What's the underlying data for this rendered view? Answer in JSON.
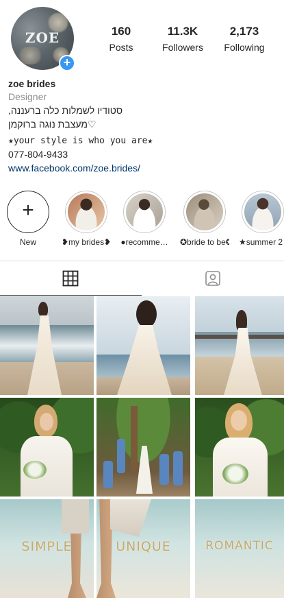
{
  "profile": {
    "avatar_text": "ZOE",
    "stats": [
      {
        "value": "160",
        "label": "Posts"
      },
      {
        "value": "11.3K",
        "label": "Followers"
      },
      {
        "value": "2,173",
        "label": "Following"
      }
    ],
    "name": "zoe brides",
    "category": "Designer",
    "bio_line1": "סטודיו לשמלות כלה ברעננה,",
    "bio_line2": "♡מעצבת נוגה ברוקמן",
    "bio_line3": "★your style is who you are★",
    "phone": "077-804-9433",
    "link": "www.facebook.com/zoe.brides/"
  },
  "highlights": [
    {
      "label": "New",
      "icon": "plus-icon"
    },
    {
      "label": "❥my brides❥"
    },
    {
      "label": "●recomme…"
    },
    {
      "label": "✪bride to be✪"
    },
    {
      "label": "★summer 2"
    }
  ],
  "tabs": [
    {
      "icon": "grid-icon",
      "active": true
    },
    {
      "icon": "tagged-person-icon",
      "active": false
    }
  ],
  "posts": [
    {
      "type": "beach"
    },
    {
      "type": "beach"
    },
    {
      "type": "beach"
    },
    {
      "type": "garden"
    },
    {
      "type": "garden"
    },
    {
      "type": "garden"
    },
    {
      "type": "word",
      "text": "SIMPLE"
    },
    {
      "type": "word",
      "text": "UNIQUE"
    },
    {
      "type": "word",
      "text": "ROMANTIC"
    }
  ],
  "colors": {
    "accent": "#3897f0",
    "link": "#003569",
    "muted": "#8e8e8e",
    "gold": "#c9a96a"
  }
}
